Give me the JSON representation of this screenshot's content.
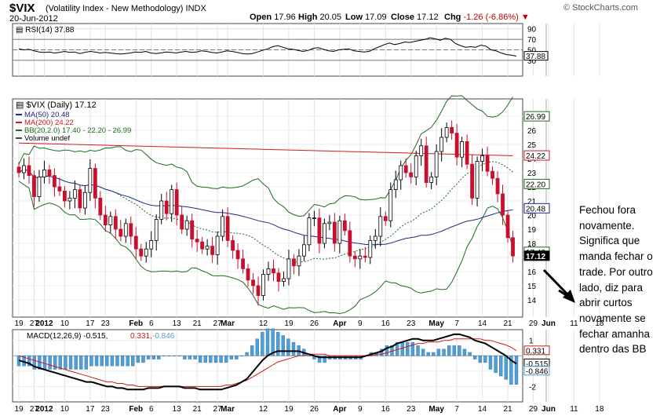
{
  "header": {
    "symbol": "$VIX",
    "name": "(Volatility Index - New Methodology)",
    "exchange": "INDX",
    "date": "20-Jun-2012",
    "brand": "© StockCharts.com",
    "open_label": "Open",
    "open": "17.96",
    "high_label": "High",
    "high": "20.05",
    "low_label": "Low",
    "low": "17.09",
    "close_label": "Close",
    "close": "17.12",
    "chg_label": "Chg",
    "chg": "-1.26 (-6.86%)"
  },
  "annotation": "Fechou fora\nnovamente.\nSignifica que\nmanda fechar o\ntrade. Por outro\nlado, diz para\nabrir curtos\nnovamente se\nfechar amanha\ndentro das BB",
  "colors": {
    "up": "#ffffff",
    "down": "#c8102e",
    "ma50": "#1f2a8c",
    "ma200": "#d11a1a",
    "bb": "#1e6b1e",
    "volume": "#4a8fd0",
    "macd_hist": "#4f9fd6"
  },
  "chart_data": [
    {
      "type": "line",
      "title": "RSI(14) 37.88",
      "ylim": [
        0,
        100
      ],
      "ticks": [
        90,
        70,
        50,
        30
      ],
      "levels": [
        70,
        50,
        30
      ],
      "last_value": "37.88",
      "series": [
        {
          "name": "RSI(14)",
          "values": [
            52,
            50,
            51,
            48,
            46,
            45,
            46,
            44,
            45,
            47,
            45,
            46,
            43,
            45,
            47,
            46,
            44,
            45,
            44,
            43,
            42,
            43,
            44,
            46,
            45,
            47,
            44,
            43,
            44,
            46,
            45,
            44,
            46,
            47,
            45,
            46,
            48,
            47,
            45,
            44,
            46,
            48,
            47,
            45,
            43,
            42,
            43,
            46,
            49,
            52,
            56,
            58,
            55,
            52,
            51,
            49,
            47,
            49,
            53,
            54,
            51,
            48,
            47,
            50,
            51,
            52,
            48,
            47,
            46,
            47,
            52,
            56,
            60,
            63,
            60,
            62,
            65,
            64,
            66,
            68,
            70,
            73,
            71,
            68,
            72,
            70,
            62,
            58,
            55,
            56,
            55,
            59,
            57,
            50,
            48,
            44,
            41,
            40,
            38
          ]
        }
      ]
    },
    {
      "type": "candlestick",
      "title": "$VIX (Daily) 17.12",
      "legend": [
        "MA(50) 20.48",
        "MA(200) 24.22",
        "BB(20,2.0) 17.40 - 22.20 - 26.99",
        "Volume undef"
      ],
      "ylim": [
        13,
        28
      ],
      "y_ticks": [
        27,
        26,
        25,
        24,
        23,
        22,
        21,
        20,
        19,
        18,
        17,
        16,
        15,
        14
      ],
      "value_labels": [
        "26.99",
        "24.22",
        "22.20",
        "20.48",
        "17.40",
        "17.12"
      ],
      "closes": [
        23.0,
        23.5,
        22.8,
        21.3,
        22.7,
        23.2,
        22.8,
        22.0,
        21.7,
        21.0,
        21.2,
        21.8,
        20.5,
        21.6,
        23.3,
        21.2,
        20.0,
        19.3,
        19.9,
        19.0,
        18.5,
        19.4,
        18.5,
        17.6,
        17.1,
        17.6,
        18.2,
        19.7,
        21.0,
        20.1,
        21.8,
        20.0,
        19.0,
        19.6,
        18.3,
        18.1,
        17.6,
        17.8,
        17.2,
        18.5,
        19.9,
        18.2,
        17.5,
        16.9,
        16.2,
        15.4,
        15.0,
        14.3,
        15.8,
        16.2,
        15.9,
        15.3,
        15.5,
        16.9,
        16.4,
        17.1,
        17.9,
        19.8,
        19.8,
        18.0,
        19.4,
        19.5,
        18.0,
        19.6,
        18.9,
        17.1,
        16.9,
        17.1,
        17.0,
        18.2,
        18.5,
        19.9,
        19.6,
        21.8,
        22.5,
        23.5,
        23.0,
        22.7,
        24.2,
        24.9,
        22.3,
        22.7,
        24.5,
        25.5,
        26.2,
        25.8,
        24.1,
        25.2,
        23.6,
        21.2,
        23.8,
        24.2,
        23.1,
        22.6,
        21.5,
        20.0,
        18.4,
        17.1
      ]
    },
    {
      "type": "line",
      "title": "MACD(12,26,9) -0.515, 0.331, -0.846",
      "ylim": [
        -3,
        1.7
      ],
      "y_ticks": [
        1,
        -1,
        -2
      ],
      "value_labels": [
        "0.331",
        "-0.515",
        "-0.846"
      ],
      "series": [
        {
          "name": "MACD(12,26,9)",
          "values": [
            -0.3,
            -0.4,
            -0.5,
            -0.7,
            -0.8,
            -0.9,
            -1.0,
            -1.1,
            -1.2,
            -1.3,
            -1.4,
            -1.5,
            -1.6,
            -1.7,
            -1.7,
            -1.8,
            -1.9,
            -2.0,
            -2.0,
            -2.1,
            -2.1,
            -2.2,
            -2.2,
            -2.2,
            -2.2,
            -2.1,
            -2.1,
            -2.1,
            -2.0,
            -2.0,
            -2.0,
            -2.0,
            -2.1,
            -2.1,
            -2.1,
            -2.2,
            -2.2,
            -2.2,
            -2.2,
            -2.2,
            -2.1,
            -2.0,
            -1.9,
            -1.7,
            -1.5,
            -1.1,
            -0.7,
            -0.3,
            0.0,
            0.2,
            0.3,
            0.3,
            0.3,
            0.3,
            0.3,
            0.2,
            0.1,
            0.0,
            -0.1,
            -0.1,
            -0.1,
            -0.1,
            -0.1,
            -0.1,
            -0.1,
            -0.1,
            -0.1,
            0.0,
            0.1,
            0.2,
            0.3,
            0.5,
            0.6,
            0.8,
            0.9,
            1.0,
            1.1,
            1.1,
            1.0,
            1.0,
            1.0,
            1.1,
            1.2,
            1.3,
            1.4,
            1.4,
            1.3,
            1.2,
            1.0,
            0.9,
            0.8,
            0.6,
            0.4,
            0.2,
            0.0,
            -0.3,
            -0.515
          ]
        },
        {
          "name": "Signal",
          "values": [
            0.0,
            -0.1,
            -0.2,
            -0.3,
            -0.4,
            -0.5,
            -0.6,
            -0.7,
            -0.8,
            -0.9,
            -1.0,
            -1.1,
            -1.2,
            -1.3,
            -1.4,
            -1.5,
            -1.6,
            -1.7,
            -1.7,
            -1.8,
            -1.8,
            -1.9,
            -1.9,
            -2.0,
            -2.0,
            -2.0,
            -2.0,
            -2.0,
            -2.0,
            -2.0,
            -2.0,
            -2.0,
            -2.0,
            -2.0,
            -2.0,
            -2.0,
            -2.0,
            -2.0,
            -2.0,
            -2.0,
            -1.9,
            -1.9,
            -1.8,
            -1.7,
            -1.6,
            -1.4,
            -1.2,
            -1.0,
            -0.8,
            -0.6,
            -0.4,
            -0.3,
            -0.2,
            -0.1,
            0.0,
            0.0,
            0.1,
            0.1,
            0.1,
            0.1,
            0.0,
            0.0,
            0.0,
            0.0,
            0.0,
            0.0,
            0.0,
            0.0,
            0.0,
            0.1,
            0.1,
            0.2,
            0.3,
            0.4,
            0.5,
            0.6,
            0.7,
            0.8,
            0.8,
            0.9,
            0.9,
            0.9,
            1.0,
            1.0,
            1.1,
            1.1,
            1.1,
            1.1,
            1.1,
            1.1,
            1.0,
            1.0,
            0.9,
            0.8,
            0.7,
            0.55,
            0.331
          ]
        }
      ]
    }
  ],
  "x_axis_labels": [
    {
      "label": "19",
      "i": 0
    },
    {
      "label": "27",
      "i": 3
    },
    {
      "label": "2012",
      "i": 5,
      "bold": true
    },
    {
      "label": "10",
      "i": 9
    },
    {
      "label": "17",
      "i": 14
    },
    {
      "label": "23",
      "i": 17
    },
    {
      "label": "Feb",
      "i": 23,
      "bold": true
    },
    {
      "label": "6",
      "i": 26
    },
    {
      "label": "13",
      "i": 31
    },
    {
      "label": "21",
      "i": 35
    },
    {
      "label": "27",
      "i": 39
    },
    {
      "label": "Mar",
      "i": 41,
      "bold": true
    },
    {
      "label": "12",
      "i": 48
    },
    {
      "label": "19",
      "i": 53
    },
    {
      "label": "26",
      "i": 58
    },
    {
      "label": "Apr",
      "i": 63,
      "bold": true
    },
    {
      "label": "9",
      "i": 67
    },
    {
      "label": "16",
      "i": 72
    },
    {
      "label": "23",
      "i": 77
    },
    {
      "label": "May",
      "i": 82,
      "bold": true
    },
    {
      "label": "7",
      "i": 86
    },
    {
      "label": "14",
      "i": 91
    },
    {
      "label": "21",
      "i": 96
    },
    {
      "label": "29",
      "i": 101
    },
    {
      "label": "Jun",
      "i": 104,
      "bold": true
    },
    {
      "label": "11",
      "i": 109
    },
    {
      "label": "18",
      "i": 114
    }
  ]
}
